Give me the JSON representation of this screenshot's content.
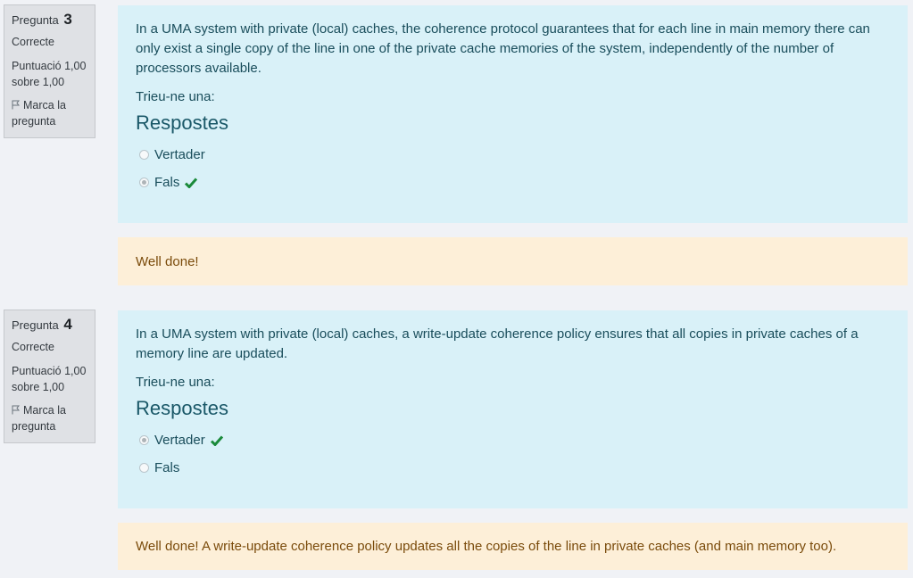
{
  "questions": [
    {
      "label": "Pregunta",
      "number": "3",
      "state": "Correcte",
      "grade": "Puntuació 1,00 sobre 1,00",
      "flag": "Marca la pregunta",
      "text": "In a UMA system with private (local) caches, the coherence protocol guarantees that for each line in main memory there can only exist a single copy of the line in one of the private cache memories of the system, independently of the number of processors available.",
      "prompt": "Trieu-ne una:",
      "answers_title": "Respostes",
      "options": [
        {
          "label": "Vertader",
          "selected": false,
          "correct": false
        },
        {
          "label": "Fals",
          "selected": true,
          "correct": true
        }
      ],
      "feedback": "Well done!"
    },
    {
      "label": "Pregunta",
      "number": "4",
      "state": "Correcte",
      "grade": "Puntuació 1,00 sobre 1,00",
      "flag": "Marca la pregunta",
      "text": "In a UMA system with private (local) caches, a write-update coherence policy ensures that all copies in private caches of a memory line are updated.",
      "prompt": "Trieu-ne una:",
      "answers_title": "Respostes",
      "options": [
        {
          "label": "Vertader",
          "selected": true,
          "correct": true
        },
        {
          "label": "Fals",
          "selected": false,
          "correct": false
        }
      ],
      "feedback": "Well done! A write-update coherence policy updates all the copies of the line in private caches (and main memory too)."
    }
  ],
  "colors": {
    "question_bg": "#d9f1f8",
    "feedback_bg": "#fdefd8",
    "info_bg": "#dfe1e5",
    "correct_check": "#1a8a3a"
  },
  "icons": {
    "flag": "flag-icon",
    "correct": "check-icon"
  }
}
